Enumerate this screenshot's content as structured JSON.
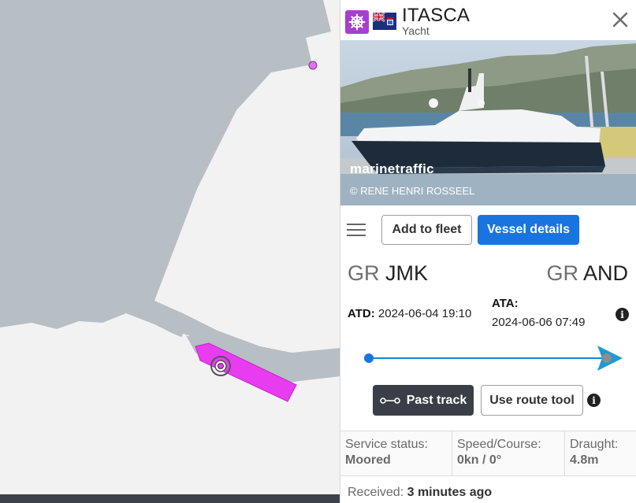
{
  "map": {
    "land_color": "#f2f2f2",
    "sea_color": "#b7bec4",
    "vessel_color": "#e83cf0",
    "anchor_marker_color": "#e66ef2"
  },
  "panel": {
    "type_icon": "ship-wheel-icon",
    "type_icon_color": "#a63ecf",
    "flag": "cayman-islands-flag",
    "vessel_name": "ITASCA",
    "vessel_type": "Yacht",
    "close_icon": "close-icon",
    "photo": {
      "watermark": "marinetraffic",
      "credit": "© RENE HENRI ROSSEEL"
    },
    "toolbar": {
      "menu_icon": "hamburger-menu-icon",
      "add_to_fleet": "Add to fleet",
      "vessel_details": "Vessel details",
      "accent_color": "#1a74e0"
    },
    "voyage": {
      "origin_country": "GR",
      "origin_port": "JMK",
      "dest_country": "GR",
      "dest_port": "AND",
      "atd_label": "ATD:",
      "atd_value": "2024-06-04 19:10",
      "ata_label": "ATA:",
      "ata_value": "2024-06-06 07:49",
      "info_icon": "info-icon",
      "progress": 1.0
    },
    "actions": {
      "past_track": "Past track",
      "past_track_icon": "track-line-icon",
      "use_route_tool": "Use route tool",
      "info_icon": "info-icon"
    },
    "stats": [
      {
        "label": "Service status:",
        "value": "Moored"
      },
      {
        "label": "Speed/Course:",
        "value": "0kn / 0°"
      },
      {
        "label": "Draught:",
        "value": "4.8m"
      }
    ],
    "received": {
      "label": "Received:",
      "value": "3 minutes ago"
    }
  }
}
